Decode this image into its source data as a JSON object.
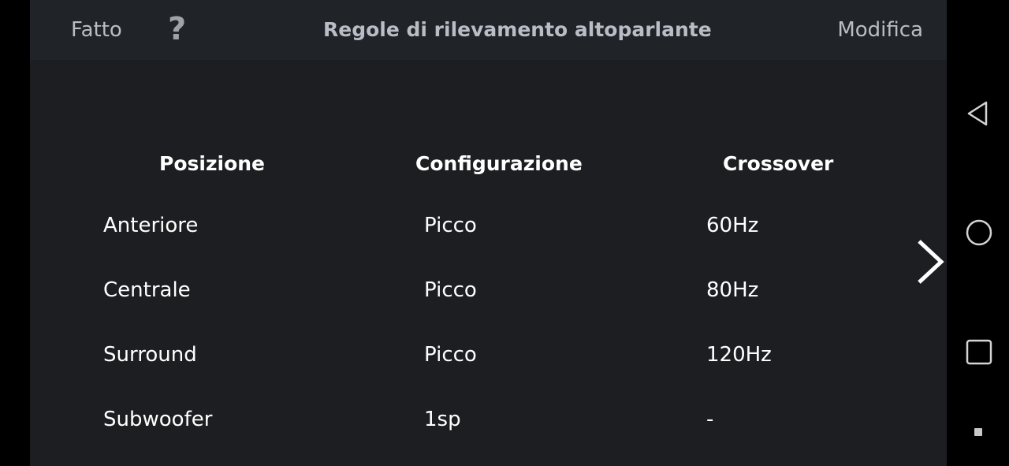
{
  "header": {
    "done_label": "Fatto",
    "help_label": "?",
    "title": "Regole di rilevamento altoparlante",
    "edit_label": "Modifica"
  },
  "table": {
    "columns": [
      "Posizione",
      "Configurazione",
      "Crossover"
    ],
    "rows": [
      {
        "position": "Anteriore",
        "configuration": "Picco",
        "crossover": "60Hz"
      },
      {
        "position": "Centrale",
        "configuration": "Picco",
        "crossover": "80Hz"
      },
      {
        "position": "Surround",
        "configuration": "Picco",
        "crossover": "120Hz"
      },
      {
        "position": "Subwoofer",
        "configuration": "1sp",
        "crossover": "-"
      }
    ]
  },
  "icons": {
    "next": "chevron-right-icon",
    "back": "back-triangle-icon",
    "home": "home-circle-icon",
    "recents": "recents-square-icon"
  },
  "colors": {
    "background": "#1c1e21",
    "header_background": "#202327",
    "header_text": "#b9bec6",
    "table_text": "#ffffff"
  }
}
